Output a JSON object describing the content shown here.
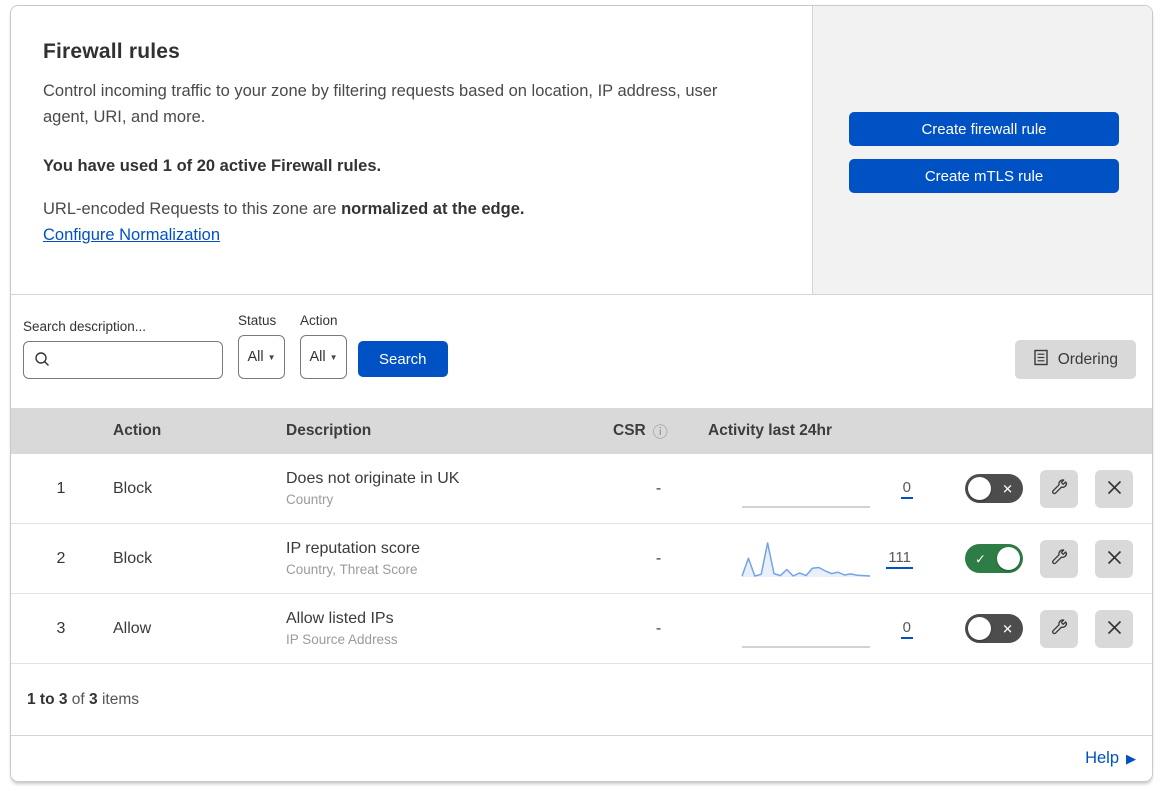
{
  "header": {
    "title": "Firewall rules",
    "description": "Control incoming traffic to your zone by filtering requests based on location, IP address, user agent, URI, and more.",
    "usage": "You have used 1 of 20 active Firewall rules.",
    "normalization_prefix": "URL-encoded Requests to this zone are ",
    "normalization_bold": "normalized at the edge.",
    "normalization_link": "Configure Normalization",
    "create_firewall_button": "Create firewall rule",
    "create_mtls_button": "Create mTLS rule"
  },
  "filters": {
    "search_label": "Search description...",
    "search_value": "",
    "status_label": "Status",
    "status_value": "All",
    "action_label": "Action",
    "action_value": "All",
    "search_button": "Search",
    "ordering_button": "Ordering"
  },
  "table": {
    "columns": {
      "action": "Action",
      "description": "Description",
      "csr": "CSR",
      "activity": "Activity last 24hr"
    },
    "rows": [
      {
        "index": "1",
        "action": "Block",
        "description": "Does not originate in UK",
        "fields": "Country",
        "csr": "-",
        "activity_count": "0",
        "enabled": false,
        "sparkline": {
          "values": [
            0,
            0
          ],
          "color": "#c3c3c3"
        }
      },
      {
        "index": "2",
        "action": "Block",
        "description": "IP reputation score",
        "fields": "Country, Threat Score",
        "csr": "-",
        "activity_count": "111",
        "enabled": true,
        "sparkline": {
          "values": [
            2,
            55,
            3,
            8,
            100,
            10,
            4,
            22,
            3,
            12,
            4,
            26,
            28,
            18,
            10,
            14,
            6,
            9,
            5,
            4,
            3
          ],
          "color": "#74a1e8",
          "fill": "#e9f0fb"
        }
      },
      {
        "index": "3",
        "action": "Allow",
        "description": "Allow listed IPs",
        "fields": "IP Source Address",
        "csr": "-",
        "activity_count": "0",
        "enabled": false,
        "sparkline": {
          "values": [
            0,
            0
          ],
          "color": "#c3c3c3"
        }
      }
    ]
  },
  "footer": {
    "range_bold": "1 to 3",
    "of_text": " of ",
    "total_bold": "3",
    "items_text": " items",
    "help_label": "Help"
  },
  "colors": {
    "accent_blue": "#0051c3",
    "toggle_on_green": "#2e7d46",
    "toggle_off_gray": "#4d4d4d",
    "sparkline_blue": "#74a1e8",
    "panel_gray": "#f2f2f2",
    "header_gray": "#d9d9d9"
  }
}
